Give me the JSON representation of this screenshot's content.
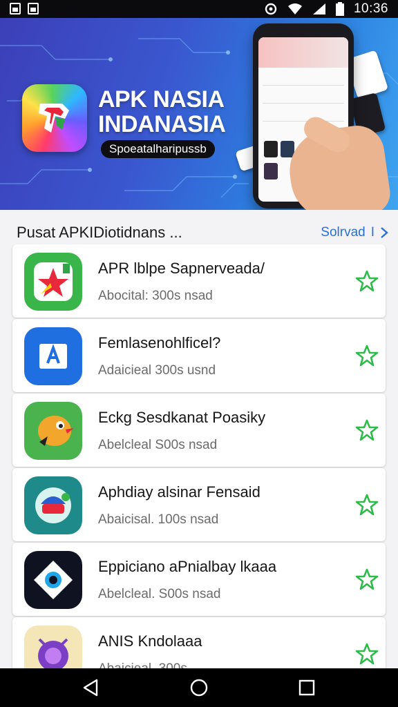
{
  "status_bar": {
    "time": "10:36",
    "left_icons": [
      "image-notification-icon",
      "gallery-notification-icon"
    ],
    "right_icons": [
      "sync-icon",
      "wifi-icon",
      "signal-icon",
      "battery-icon"
    ]
  },
  "banner": {
    "title_line1": "APK NASIA",
    "title_line2": "INDANASIA",
    "subtitle": "Spoeatalharipussb",
    "logo_icon": "apk-logo-icon",
    "colors": {
      "gradient_start": "#3c3fb8",
      "gradient_end": "#3fa4f0"
    }
  },
  "section": {
    "title": "Pusat APKIDiotidnans ...",
    "link_label": "Solrvad",
    "link_icon": "chevron-right-icon",
    "accent": "#2a6fd6"
  },
  "apps": [
    {
      "name": "APR lblpe Sapnerveada/",
      "meta": "Abocital: 300s nsad",
      "icon": "red-star-app-icon",
      "icon_bg": "#3ab54a"
    },
    {
      "name": "Femlasenohlficel?",
      "meta": "Adaicieal 300s usnd",
      "icon": "blue-a-app-icon",
      "icon_bg": "#1f6fe0"
    },
    {
      "name": "Eckg Sesdkanat Poasiky",
      "meta": "Abelcleal S00s nsad",
      "icon": "bird-app-icon",
      "icon_bg": "#4ab34e"
    },
    {
      "name": "Aphdiay alsinar Fensaid",
      "meta": "Abaicisal. 100s nsad",
      "icon": "robot-app-icon",
      "icon_bg": "#1f8a8a"
    },
    {
      "name": "Eppiciano aPnialbay lkaaa",
      "meta": "Abelcleal. S00s nsad",
      "icon": "diamond-app-icon",
      "icon_bg": "#0f1220"
    },
    {
      "name": "ANIS Kndolaaa",
      "meta": "Abaicieal. 300s",
      "icon": "purple-circle-app-icon",
      "icon_bg": "#f4e6b6"
    }
  ],
  "favorite_icon": "star-outline-icon",
  "favorite_color": "#2dbb4a",
  "nav_bar": {
    "buttons": [
      "back-icon",
      "home-icon",
      "recents-icon"
    ]
  }
}
